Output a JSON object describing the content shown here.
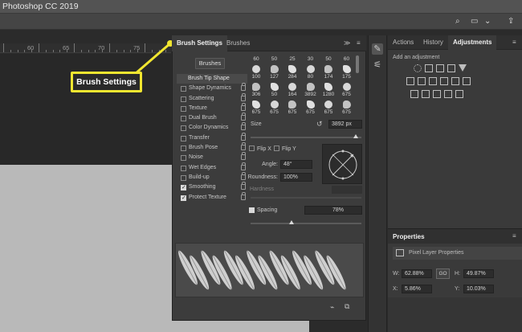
{
  "app": {
    "title": "Photoshop CC 2019"
  },
  "ruler": {
    "labels": [
      "60",
      "65",
      "70",
      "75"
    ]
  },
  "callout": {
    "text": "Brush Settings"
  },
  "brush_panel": {
    "tabs": [
      "Brush Settings",
      "Brushes"
    ],
    "menu_glyph": "≫",
    "brushes_button": "Brushes",
    "options": [
      {
        "label": "Brush Tip Shape",
        "header": true
      },
      {
        "label": "Shape Dynamics",
        "checked": false,
        "lock": true
      },
      {
        "label": "Scattering",
        "checked": false,
        "lock": true
      },
      {
        "label": "Texture",
        "checked": false,
        "lock": true
      },
      {
        "label": "Dual Brush",
        "checked": false,
        "lock": true
      },
      {
        "label": "Color Dynamics",
        "checked": false,
        "lock": true
      },
      {
        "label": "Transfer",
        "checked": false,
        "lock": true
      },
      {
        "label": "Brush Pose",
        "checked": false,
        "lock": true
      },
      {
        "label": "Noise",
        "checked": false,
        "lock": true
      },
      {
        "label": "Wet Edges",
        "checked": false,
        "lock": true
      },
      {
        "label": "Build-up",
        "checked": false,
        "lock": true
      },
      {
        "label": "Smoothing",
        "checked": true,
        "lock": true
      },
      {
        "label": "Protect Texture",
        "checked": true,
        "lock": true
      }
    ],
    "brush_top_labels": [
      "60",
      "50",
      "25",
      "30",
      "50",
      "60"
    ],
    "brush_rows": [
      [
        "100",
        "127",
        "284",
        "80",
        "174",
        "175"
      ],
      [
        "306",
        "50",
        "164",
        "3892",
        "1280",
        "675"
      ],
      [
        "675",
        "675",
        "675",
        "675",
        "675",
        "675"
      ]
    ],
    "size_label": "Size",
    "size_value": "3892 px",
    "flip_x": "Flip X",
    "flip_y": "Flip Y",
    "angle_label": "Angle:",
    "angle_value": "48°",
    "roundness_label": "Roundness:",
    "roundness_value": "100%",
    "hardness_label": "Hardness",
    "spacing_label": "Spacing",
    "spacing_value": "78%",
    "spacing_checked": true
  },
  "right_panel": {
    "tabs": [
      "Actions",
      "History",
      "Adjustments"
    ],
    "adjustments_title": "Add an adjustment",
    "properties": {
      "title": "Properties",
      "subtitle": "Pixel Layer Properties",
      "w_label": "W:",
      "w_value": "62.88%",
      "h_label": "H:",
      "h_value": "49.87%",
      "link_glyph": "GO",
      "x_label": "X:",
      "x_value": "5.86%",
      "y_label": "Y:",
      "y_value": "10.03%"
    }
  },
  "colors": {
    "accent_yellow": "#f1e630",
    "panel": "#3c3c3c",
    "canvas": "#b9b9b9"
  }
}
